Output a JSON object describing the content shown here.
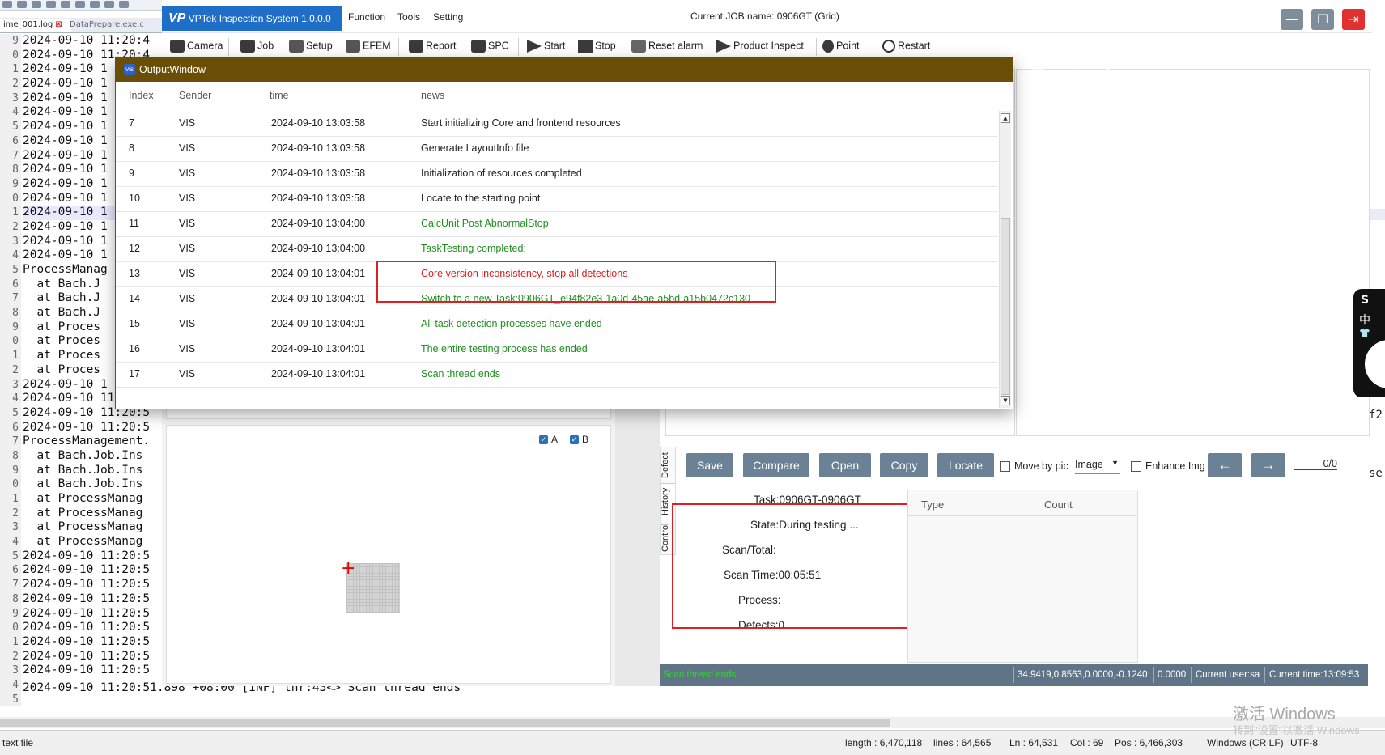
{
  "editor": {
    "tabs": [
      "ime_001.log",
      "DataPrepare.exe.c"
    ],
    "gutter": [
      "9",
      "0",
      "1",
      "2",
      "3",
      "4",
      "5",
      "6",
      "7",
      "8",
      "9",
      "0",
      "1",
      "2",
      "3",
      "4",
      "5",
      "6",
      "7",
      "8",
      "9",
      "0",
      "1",
      "2",
      "3",
      "4",
      "5",
      "6",
      "7",
      "8",
      "9",
      "0",
      "1",
      "2",
      "3",
      "4",
      "5",
      "6",
      "7",
      "8",
      "9",
      "0",
      "1",
      "2",
      "3",
      "4",
      "5"
    ],
    "lines": [
      "2024-09-10 11:20:4",
      "2024-09-10 11:20:4",
      "2024-09-10 1",
      "2024-09-10 1",
      "2024-09-10 1",
      "2024-09-10 1",
      "2024-09-10 1",
      "2024-09-10 1",
      "2024-09-10 1",
      "2024-09-10 1",
      "2024-09-10 1",
      "2024-09-10 1",
      "2024-09-10 1",
      "2024-09-10 1",
      "2024-09-10 1",
      "2024-09-10 1",
      "ProcessManag",
      "  at Bach.J",
      "  at Bach.J",
      "  at Bach.J",
      "  at Proces",
      "  at Proces",
      "  at Proces",
      "  at Proces",
      "2024-09-10 1",
      "2024-09-10 11:20:5",
      "2024-09-10 11:20:5",
      "2024-09-10 11:20:5",
      "ProcessManagement.",
      "  at Bach.Job.Ins",
      "  at Bach.Job.Ins",
      "  at Bach.Job.Ins",
      "  at ProcessManag",
      "  at ProcessManag",
      "  at ProcessManag",
      "  at ProcessManag",
      "2024-09-10 11:20:5",
      "2024-09-10 11:20:5",
      "2024-09-10 11:20:5",
      "2024-09-10 11:20:5",
      "2024-09-10 11:20:5",
      "2024-09-10 11:20:5",
      "2024-09-10 11:20:5",
      "2024-09-10 11:20:5",
      "2024-09-10 11:20:5"
    ],
    "last_line": "2024-09-10 11:20:51.898 +08:00 [INF] thr:43<> Scan thread ends",
    "status": {
      "type": "text file",
      "length": "length : 6,470,118",
      "lines": "lines : 64,565",
      "ln": "Ln : 64,531",
      "col": "Col : 69",
      "pos": "Pos : 6,466,303",
      "eol": "Windows (CR LF)",
      "encoding": "UTF-8"
    },
    "watermark_title": "激活 Windows",
    "watermark_sub": "转到\"设置\"以激活 Windows"
  },
  "app": {
    "logo_text": "VPTek Inspection System 1.0.0.0",
    "menu": [
      "Function",
      "Tools",
      "Setting"
    ],
    "job_label": "Current JOB name:",
    "job_name": "0906GT (Grid)",
    "toolbar": [
      "Camera",
      "Job",
      "Setup",
      "EFEM",
      "Report",
      "SPC",
      "Start",
      "Stop",
      "Reset alarm",
      "Product Inspect",
      "Point",
      "Restart"
    ],
    "checks": {
      "a": "A",
      "b": "B"
    },
    "controls": {
      "save": "Save",
      "compare": "Compare",
      "open": "Open",
      "copy": "Copy",
      "locate": "Locate",
      "move_by_pic": "Move by pic",
      "image": "Image",
      "enhance": "Enhance Img",
      "prev": "←",
      "next": "→",
      "pager": "0/0"
    },
    "side_tabs": [
      "Defect",
      "History",
      "Control"
    ],
    "status_panel": {
      "task": "Task:0906GT-0906GT",
      "state": "State:During testing ...",
      "scan_total": "Scan/Total:",
      "scan_time": "Scan Time:00:05:51",
      "process": "Process:",
      "defects": "Defects:0"
    },
    "defect_table": {
      "col_type": "Type",
      "col_count": "Count"
    },
    "statusbar": {
      "message": "Scan thread ends",
      "coords": "34.9419,0.8563,0.0000,-0.1240",
      "value": "0.0000",
      "user": "Current user:sa",
      "time": "Current time:13:09:53"
    },
    "right_cut": {
      "a": "f2",
      "b": "se."
    },
    "ime": [
      "S",
      "中",
      "👕"
    ]
  },
  "output_window": {
    "title": "OutputWindow",
    "icon_label": "vis",
    "columns": {
      "index": "Index",
      "sender": "Sender",
      "time": "time",
      "news": "news"
    },
    "rows": [
      {
        "index": "7",
        "sender": "VIS",
        "time": "2024-09-10 13:03:58",
        "news": "Start initializing Core and frontend resources",
        "color": "#222222"
      },
      {
        "index": "8",
        "sender": "VIS",
        "time": "2024-09-10 13:03:58",
        "news": "Generate LayoutInfo file",
        "color": "#222222"
      },
      {
        "index": "9",
        "sender": "VIS",
        "time": "2024-09-10 13:03:58",
        "news": "Initialization of resources completed",
        "color": "#222222"
      },
      {
        "index": "10",
        "sender": "VIS",
        "time": "2024-09-10 13:03:58",
        "news": "Locate to the starting point",
        "color": "#222222"
      },
      {
        "index": "11",
        "sender": "VIS",
        "time": "2024-09-10 13:04:00",
        "news": "CalcUnit Post AbnormalStop",
        "color": "#1f8f1f"
      },
      {
        "index": "12",
        "sender": "VIS",
        "time": "2024-09-10 13:04:00",
        "news": "TaskTesting completed:",
        "color": "#1f8f1f"
      },
      {
        "index": "13",
        "sender": "VIS",
        "time": "2024-09-10 13:04:01",
        "news": "Core version inconsistency, stop all detections",
        "color": "#e02020"
      },
      {
        "index": "14",
        "sender": "VIS",
        "time": "2024-09-10 13:04:01",
        "news": "Switch to a new Task:0906GT_e94f82e3-1a0d-45ae-a5bd-a15b0472c130",
        "color": "#1f8f1f"
      },
      {
        "index": "15",
        "sender": "VIS",
        "time": "2024-09-10 13:04:01",
        "news": "All task detection processes have ended",
        "color": "#1f8f1f"
      },
      {
        "index": "16",
        "sender": "VIS",
        "time": "2024-09-10 13:04:01",
        "news": "The entire testing process has ended",
        "color": "#1f8f1f"
      },
      {
        "index": "17",
        "sender": "VIS",
        "time": "2024-09-10 13:04:01",
        "news": "Scan thread ends",
        "color": "#1f8f1f"
      }
    ]
  },
  "colors": {
    "title_bar": "#6a4e06",
    "accent": "#1f6ec8",
    "button": "#6b8296",
    "ok": "#1f8f1f",
    "error": "#e02020"
  }
}
